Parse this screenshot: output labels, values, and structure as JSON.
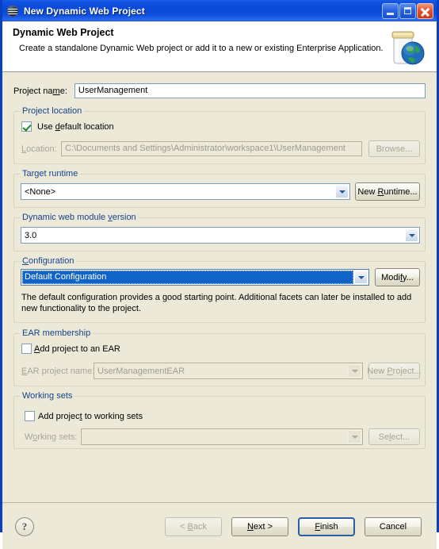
{
  "window": {
    "title": "New Dynamic Web Project",
    "title_icon": "eclipse-wizard-icon",
    "minimize_label": "minimize-icon",
    "maximize_label": "maximize-icon",
    "close_label": "close-icon",
    "border_color": "#0a40c4",
    "titlebar_color": "#0b49d8",
    "background_color": "#ece9d8"
  },
  "header": {
    "title": "Dynamic Web Project",
    "description": "Create a standalone Dynamic Web project or add it to a new or existing Enterprise Application.",
    "banner_icon": "jar-with-globe-icon"
  },
  "form": {
    "project_name": {
      "label": "Project name:",
      "value": "UserManagement"
    },
    "project_location": {
      "group_title": "Project location",
      "use_default_checkbox": {
        "label": "Use default location",
        "checked": true
      },
      "location": {
        "label": "Location:",
        "value": "C:\\Documents and Settings\\Administrator\\workspace1\\UserManagement",
        "enabled": false
      },
      "browse_button": {
        "label": "Browse...",
        "enabled": false
      }
    },
    "target_runtime": {
      "group_title": "Target runtime",
      "value": "<None>",
      "new_runtime_button": "New Runtime..."
    },
    "module_version": {
      "group_title": "Dynamic web module version",
      "value": "3.0"
    },
    "configuration": {
      "group_title": "Configuration",
      "value": "Default Configuration",
      "modify_button": "Modify...",
      "description": "The default configuration provides a good starting point. Additional facets can later be installed to add new functionality to the project.",
      "highlight_color": "#1064c8"
    },
    "ear_membership": {
      "group_title": "EAR membership",
      "add_checkbox": {
        "label": "Add project to an EAR",
        "checked": false
      },
      "ear_project_name": {
        "label": "EAR project name:",
        "value": "UserManagementEAR",
        "enabled": false
      },
      "new_project_button": {
        "label": "New Project...",
        "enabled": false
      }
    },
    "working_sets": {
      "group_title": "Working sets",
      "add_checkbox": {
        "label": "Add project to working sets",
        "checked": false
      },
      "working_sets_combo": {
        "label": "Working sets:",
        "value": "",
        "enabled": false
      },
      "select_button": {
        "label": "Select...",
        "enabled": false
      }
    }
  },
  "footer": {
    "help_icon": "question-mark-icon",
    "back_button": {
      "label": "< Back",
      "enabled": false
    },
    "next_button": {
      "label": "Next >",
      "enabled": true
    },
    "finish_button": {
      "label": "Finish",
      "enabled": true,
      "is_default": true
    },
    "cancel_button": {
      "label": "Cancel",
      "enabled": true
    }
  }
}
